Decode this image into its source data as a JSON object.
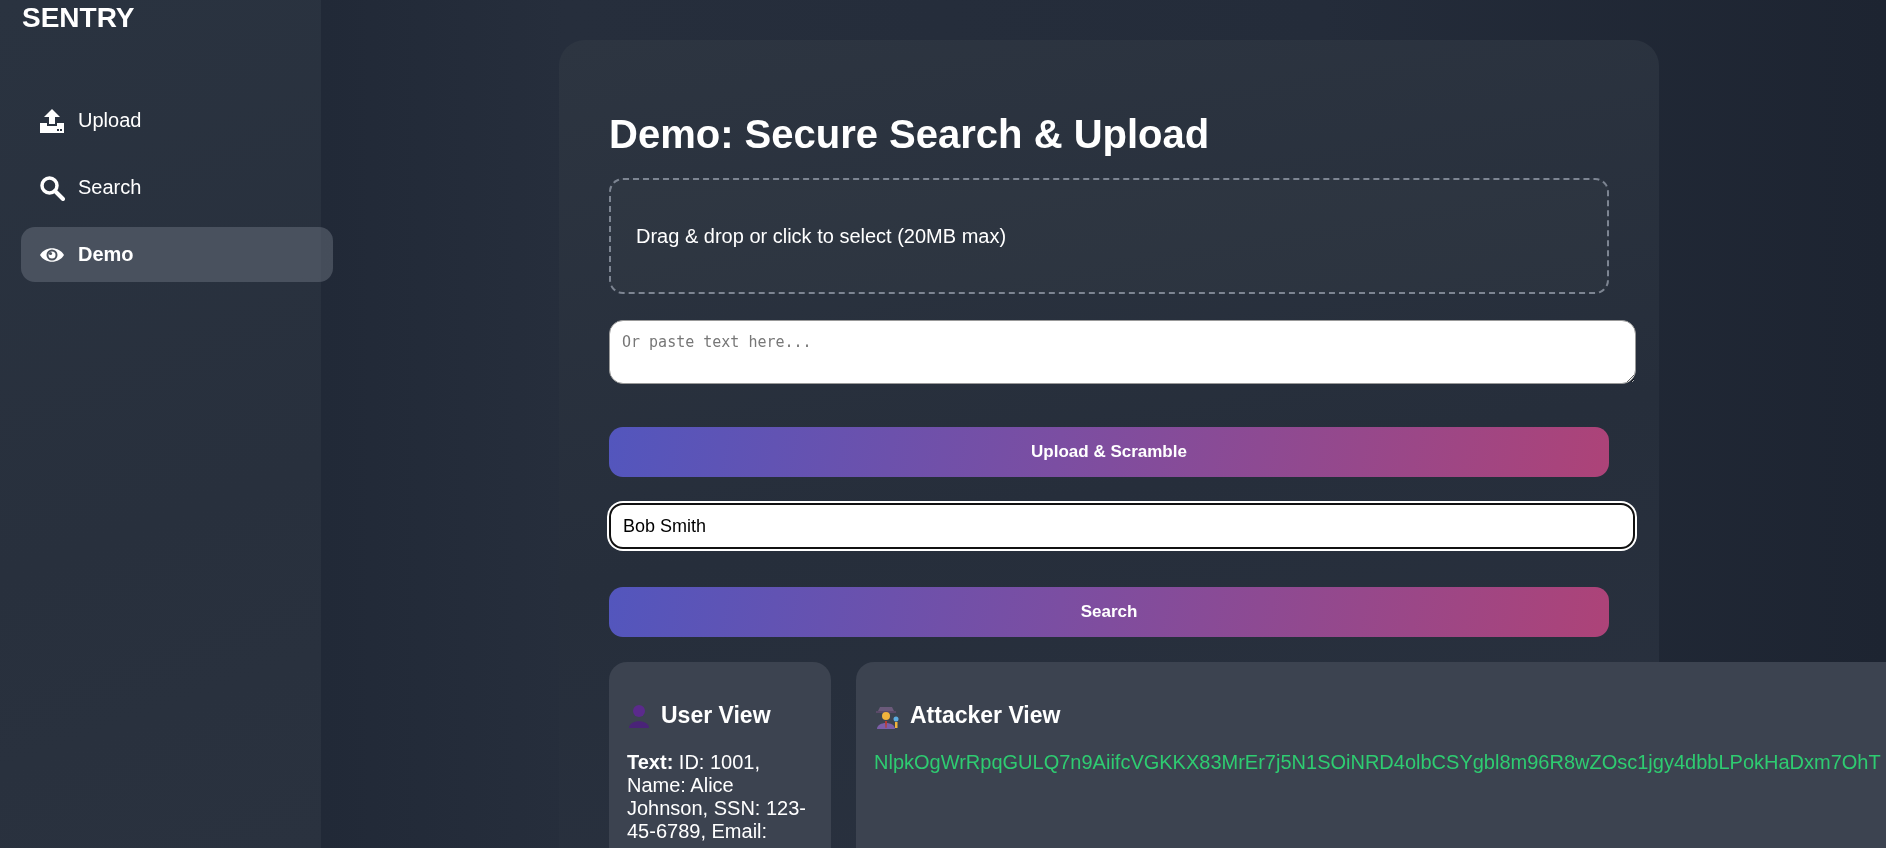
{
  "sidebar": {
    "title": "SENTRY",
    "items": [
      {
        "kind": "upload",
        "label": "Upload",
        "selected": false
      },
      {
        "kind": "search",
        "label": "Search",
        "selected": false
      },
      {
        "kind": "demo",
        "label": "Demo",
        "selected": true
      }
    ]
  },
  "main": {
    "heading": "Demo: Secure Search & Upload",
    "dropzone": {
      "text": "Drag & drop or click to select (20MB max)"
    },
    "paste_field": {
      "placeholder": "Or paste text here..."
    },
    "upload_button": "Upload & Scramble",
    "search_field": {
      "value": "Bob Smith"
    },
    "search_button": "Search",
    "views": [
      {
        "kind": "user",
        "title": "User View",
        "text": "**Text:** ID: 1001, Name: Alice Johnson, SSN: 123-45-6789, Email:"
      },
      {
        "kind": "attacker",
        "title": "Attacker View",
        "text": "NlpkOgWrRpqGULQ7n9AiifcVGKKX83MrEr7j5N1SOiNRD4olbCSYgbl8m96R8wZOsc1jgy4dbbLPokHaDxm7OhT"
      }
    ]
  }
}
